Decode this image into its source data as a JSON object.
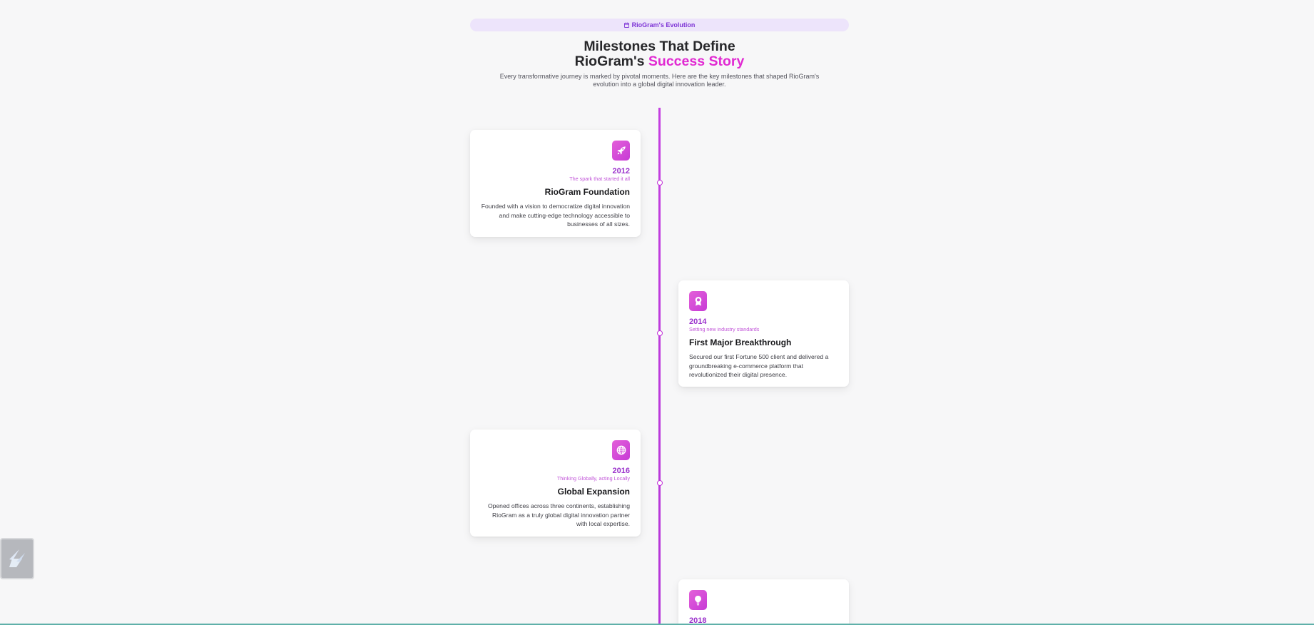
{
  "header": {
    "badge_label": "RioGram's Evolution",
    "title_line1": "Milestones That Define",
    "title_line2_prefix": "RioGram's ",
    "title_line2_accent": "Success Story",
    "subtitle": "Every transformative journey is marked by pivotal moments. Here are the key milestones that shaped RioGram's evolution into a global digital innovation leader."
  },
  "colors": {
    "accent": "#e12ad2",
    "timeline": "#c43fe0",
    "badge_bg": "#ede4fb",
    "year": "#9b32cc"
  },
  "milestones": [
    {
      "icon": "rocket-icon",
      "year": "2012",
      "tagline": "The spark that started it all",
      "title": "RioGram Foundation",
      "description": "Founded with a vision to democratize digital innovation and make cutting-edge technology accessible to businesses of all sizes."
    },
    {
      "icon": "award-icon",
      "year": "2014",
      "tagline": "Setting new industry standards",
      "title": "First Major Breakthrough",
      "description": "Secured our first Fortune 500 client and delivered a groundbreaking e-commerce platform that revolutionized their digital presence."
    },
    {
      "icon": "globe-icon",
      "year": "2016",
      "tagline": "Thinking Globally, acting Locally",
      "title": "Global Expansion",
      "description": "Opened offices across three continents, establishing RioGram as a truly global digital innovation partner with local expertise."
    },
    {
      "icon": "lightbulb-icon",
      "year": "2018",
      "tagline": "",
      "title": "",
      "description": ""
    }
  ]
}
